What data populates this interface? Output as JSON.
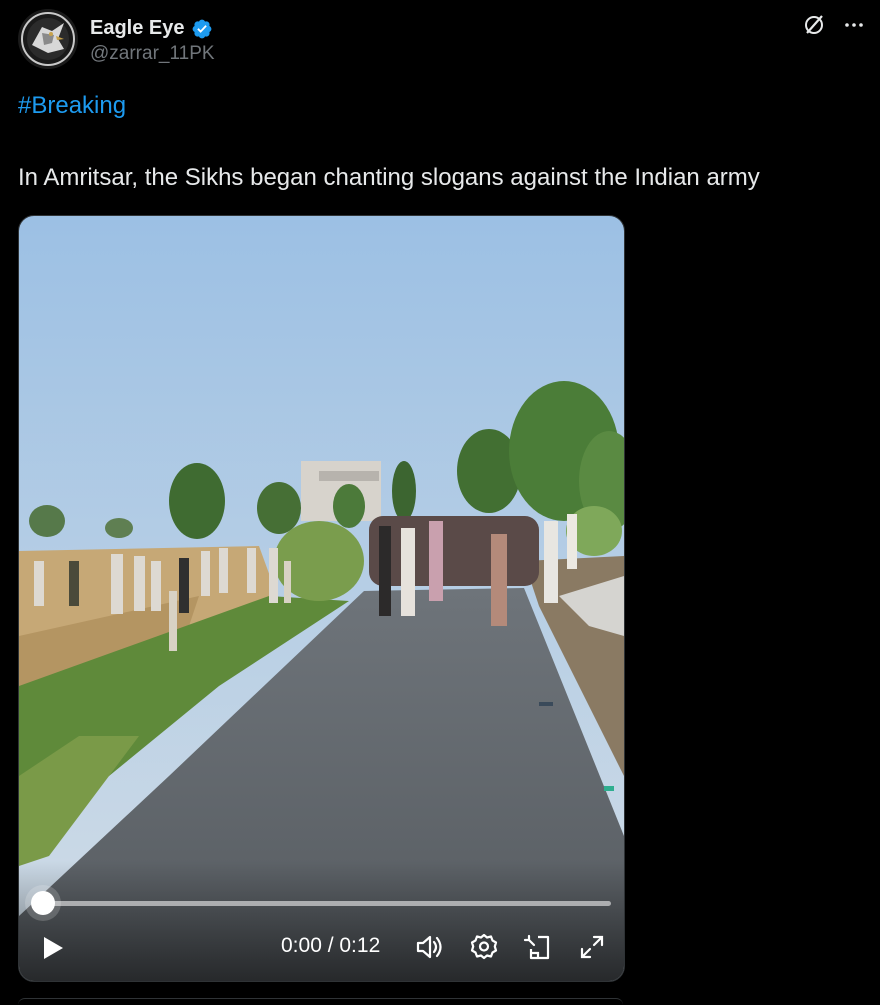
{
  "post": {
    "author": {
      "display_name": "Eagle Eye",
      "handle": "@zarrar_11PK",
      "verified": true,
      "avatar": "eagle-logo-avatar"
    },
    "hashtag": "#Breaking",
    "text": "In Amritsar, the Sikhs began chanting slogans against the Indian army",
    "header_icons": [
      "grok-icon",
      "more-icon"
    ]
  },
  "video": {
    "time_display": "0:00 / 0:12",
    "progress_fraction": 0,
    "controls": [
      "play-icon",
      "volume-icon",
      "settings-icon",
      "picture-in-picture-icon",
      "fullscreen-icon"
    ]
  },
  "colors": {
    "background": "#000000",
    "text": "#e7e9ea",
    "secondary_text": "#71767b",
    "link": "#1d9bf0",
    "verified": "#1d9bf0"
  }
}
